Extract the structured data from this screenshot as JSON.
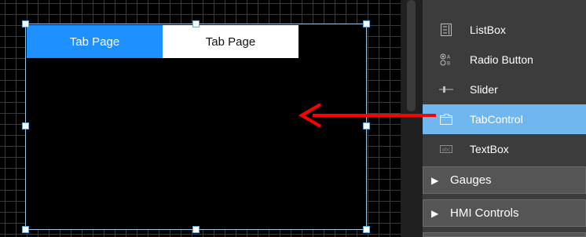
{
  "canvas": {
    "tab_control": {
      "tabs": [
        {
          "label": "Tab Page",
          "active": true
        },
        {
          "label": "Tab Page",
          "active": false
        }
      ],
      "active_color": "#1e90ff"
    },
    "arrow_color": "#ff0000"
  },
  "toolbox": {
    "items": [
      {
        "label": "ListBox",
        "icon": "listbox-icon",
        "selected": false
      },
      {
        "label": "Radio Button",
        "icon": "radio-button-icon",
        "selected": false
      },
      {
        "label": "Slider",
        "icon": "slider-icon",
        "selected": false
      },
      {
        "label": "TabControl",
        "icon": "tabcontrol-icon",
        "selected": true
      },
      {
        "label": "TextBox",
        "icon": "textbox-icon",
        "selected": false
      }
    ],
    "groups": [
      {
        "label": "Gauges",
        "expanded": false
      },
      {
        "label": "HMI Controls",
        "expanded": false
      }
    ],
    "selected_color": "#6fb7ee"
  }
}
